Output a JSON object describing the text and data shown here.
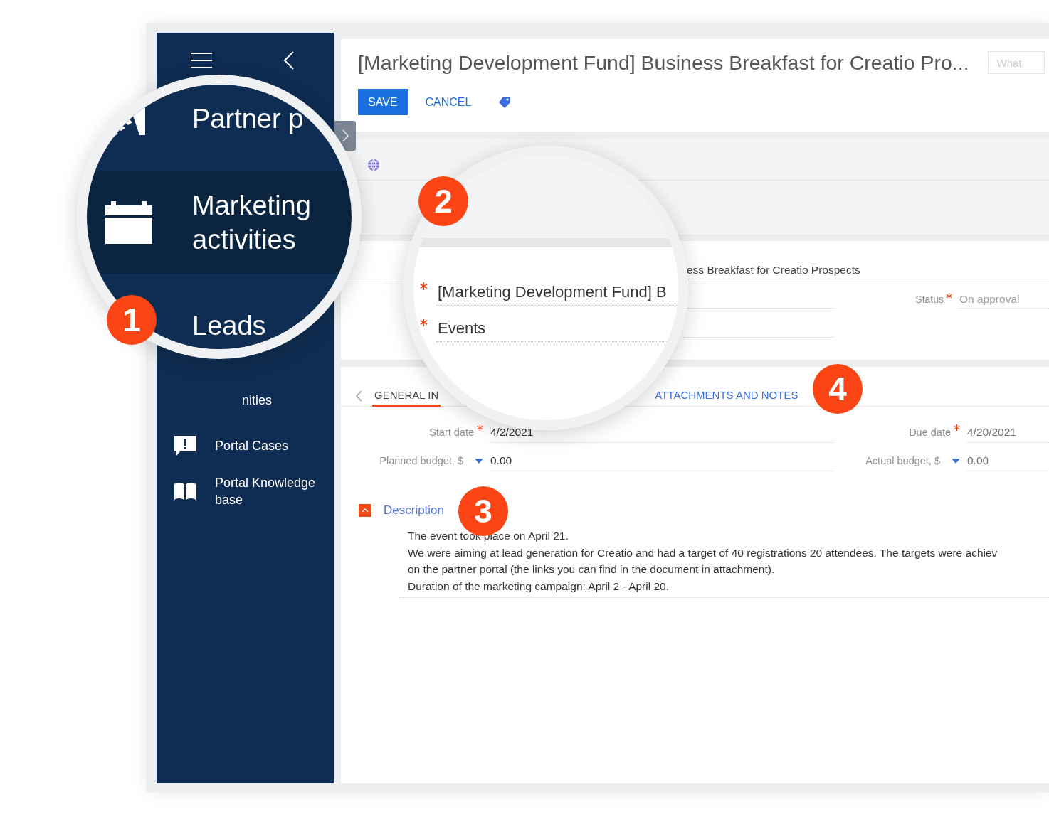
{
  "sidebar": {
    "items": [
      {
        "kind": "partial",
        "label": "nities",
        "selected": false
      },
      {
        "kind": "cases",
        "label": "Portal Cases",
        "selected": false
      },
      {
        "kind": "book",
        "label": "Portal Knowledge base",
        "selected": false
      }
    ]
  },
  "header": {
    "title": "[Marketing Development Fund] Business Breakfast for Creatio Pro...",
    "search": {
      "placeholder": "What"
    },
    "save": "SAVE",
    "cancel": "CANCEL"
  },
  "record": {
    "name_value": "ess Breakfast for Creatio Prospects",
    "status": {
      "label": "Status",
      "required": true,
      "value": "On approval"
    }
  },
  "tabs": [
    {
      "label": "GENERAL IN",
      "selected": true
    },
    {
      "label": "ATTACHMENTS AND NOTES",
      "selected": false
    }
  ],
  "fields": [
    {
      "kind": "date",
      "label": "Start date",
      "required": true,
      "value": "4/2/2021"
    },
    {
      "kind": "date",
      "label": "Due date",
      "required": true,
      "value": "4/20/2021"
    },
    {
      "kind": "currency",
      "label": "Planned budget, $",
      "required": false,
      "value": "0.00"
    },
    {
      "kind": "currency",
      "label": "Actual budget, $",
      "required": false,
      "value": "0.00"
    }
  ],
  "description": {
    "title": "Description",
    "expanded": true,
    "lines": [
      "The event took place on  April 21.",
      "We were aiming at lead generation for Creatio and had a target of 40 registrations 20 attendees. The targets were achiev",
      "on the partner portal (the links you can find in the document in attachment).",
      "Duration of the marketing campaign: April 2 - April 20."
    ]
  },
  "magnifier_1": {
    "items": [
      {
        "kind": "partner",
        "label": "Partner p",
        "selected": false
      },
      {
        "kind": "calendar",
        "label": "Marketing activities",
        "selected": true
      },
      {
        "kind": "none",
        "label": "Leads",
        "selected": false
      }
    ]
  },
  "magnifier_2": {
    "fields": [
      {
        "required": true,
        "value": "[Marketing Development Fund] B"
      },
      {
        "required": true,
        "value": "Events"
      }
    ]
  },
  "callouts": [
    "1",
    "2",
    "3",
    "4"
  ]
}
